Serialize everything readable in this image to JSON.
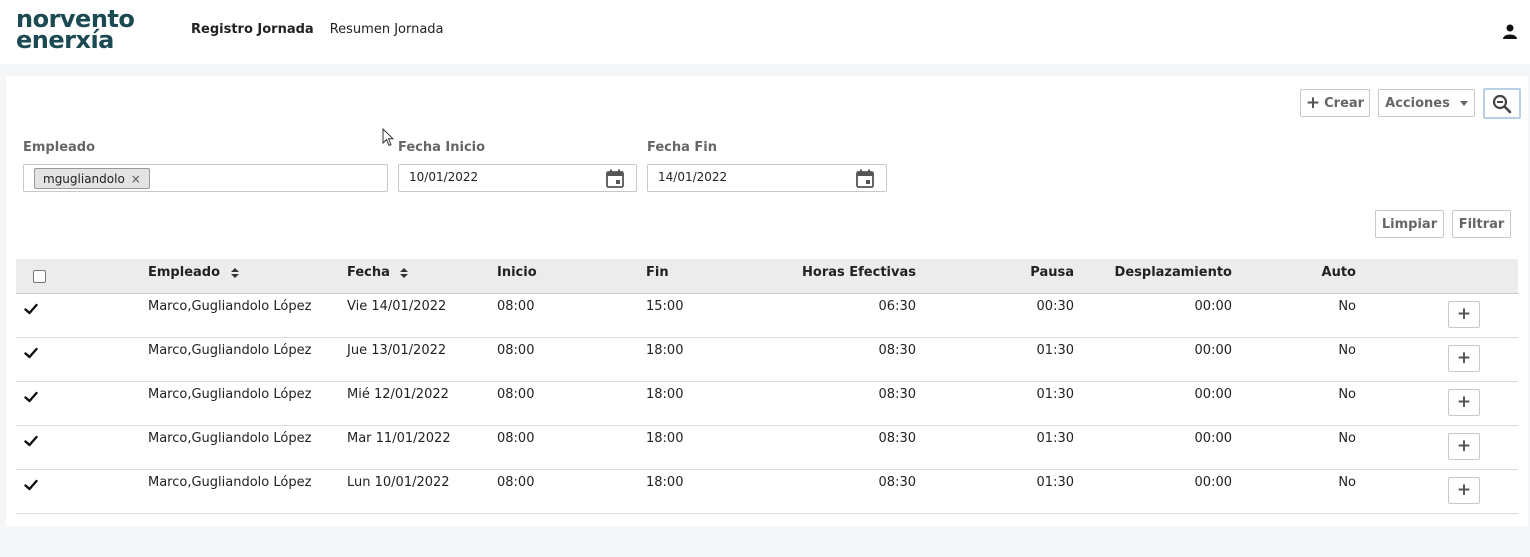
{
  "header": {
    "logo_line1": "norvento",
    "logo_line2": "enerxía",
    "nav": [
      "Registro Jornada",
      "Resumen Jornada"
    ]
  },
  "toolbar": {
    "crear_label": "Crear",
    "acciones_label": "Acciones"
  },
  "filters": {
    "empleado_label": "Empleado",
    "empleado_chip": "mgugliandolo",
    "fecha_inicio_label": "Fecha Inicio",
    "fecha_inicio_value": "10/01/2022",
    "fecha_fin_label": "Fecha Fin",
    "fecha_fin_value": "14/01/2022",
    "limpiar_label": "Limpiar",
    "filtrar_label": "Filtrar"
  },
  "table": {
    "headers": [
      "Empleado",
      "Fecha",
      "Inicio",
      "Fin",
      "Horas Efectivas",
      "Pausa",
      "Desplazamiento",
      "Auto"
    ],
    "rows": [
      [
        "Marco,Gugliandolo López",
        "Vie 14/01/2022",
        "08:00",
        "15:00",
        "06:30",
        "00:30",
        "00:00",
        "No"
      ],
      [
        "Marco,Gugliandolo López",
        "Jue 13/01/2022",
        "08:00",
        "18:00",
        "08:30",
        "01:30",
        "00:00",
        "No"
      ],
      [
        "Marco,Gugliandolo López",
        "Mié 12/01/2022",
        "08:00",
        "18:00",
        "08:30",
        "01:30",
        "00:00",
        "No"
      ],
      [
        "Marco,Gugliandolo López",
        "Mar 11/01/2022",
        "08:00",
        "18:00",
        "08:30",
        "01:30",
        "00:00",
        "No"
      ],
      [
        "Marco,Gugliandolo López",
        "Lun 10/01/2022",
        "08:00",
        "18:00",
        "08:30",
        "01:30",
        "00:00",
        "No"
      ]
    ]
  },
  "colors": {
    "brand": "#1c4a52",
    "header_bg": "#ececec",
    "page_bg": "#f4f6f8"
  }
}
